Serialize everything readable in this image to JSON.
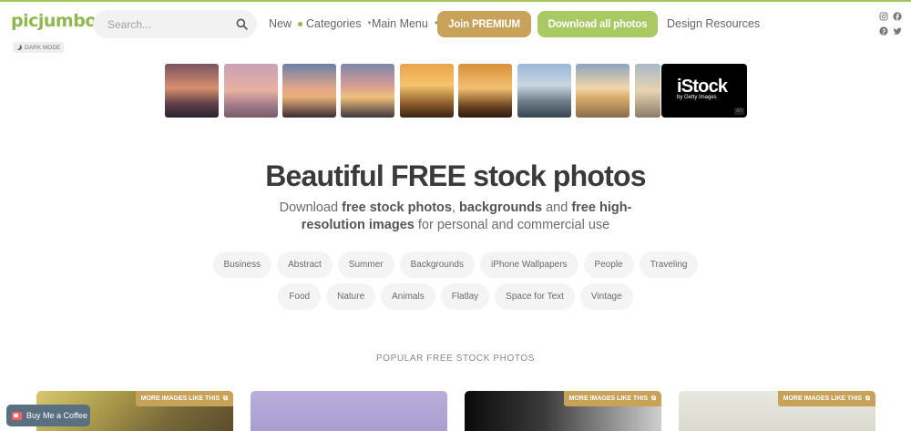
{
  "header": {
    "logo": "picjumbo",
    "dark_mode_label": "DARK MODE",
    "search": {
      "placeholder": "Search..."
    },
    "nav": {
      "new": "New",
      "categories": "Categories",
      "main_menu": "Main Menu"
    },
    "premium_button": "Join PREMIUM",
    "download_button": "Download all photos",
    "design_resources": "Design Resources",
    "social_icons": [
      "instagram-icon",
      "facebook-icon",
      "pinterest-icon",
      "twitter-icon"
    ]
  },
  "ad": {
    "brand": "iStock",
    "sub": "by Getty Images",
    "badge": "AD"
  },
  "hero": {
    "title": "Beautiful FREE stock photos",
    "subtitle_parts": [
      "Download ",
      "free stock photos",
      ", ",
      "backgrounds",
      " and ",
      "free high-resolution images",
      " for personal and commercial use"
    ]
  },
  "tags": {
    "row1": [
      "Business",
      "Abstract",
      "Summer",
      "Backgrounds",
      "iPhone Wallpapers",
      "People",
      "Traveling"
    ],
    "row2": [
      "Food",
      "Nature",
      "Animals",
      "Flatlay",
      "Space for Text",
      "Vintage"
    ]
  },
  "section": {
    "title": "POPULAR FREE STOCK PHOTOS"
  },
  "cards": {
    "more_label": "MORE IMAGES LIKE THIS"
  },
  "coffee": {
    "label": "Buy Me a Coffee"
  },
  "colors": {
    "brand_green": "#8fb84f",
    "premium_gold": "#c9a25a",
    "download_green": "#a9c962"
  }
}
